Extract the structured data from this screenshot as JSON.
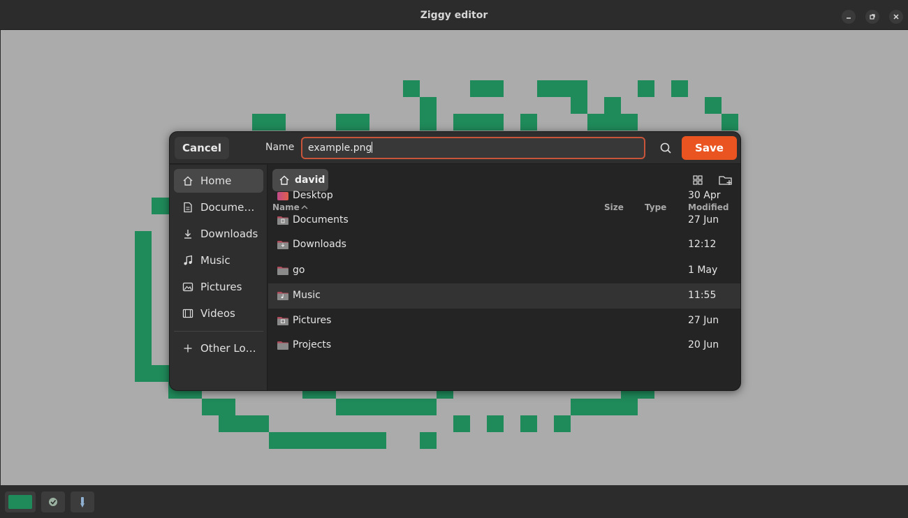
{
  "window": {
    "title": "Ziggy editor",
    "controls": [
      "minimize-icon",
      "restore-icon",
      "close-icon"
    ]
  },
  "canvas": {
    "background": "#ababab",
    "pixel_color": "#1f8a5a"
  },
  "bottom_bar": {
    "current_color": "#1f8a5a",
    "tools": [
      "color-swatch",
      "check-tool-icon",
      "dropper-tool-icon"
    ]
  },
  "dialog": {
    "cancel_label": "Cancel",
    "name_label": "Name",
    "name_value": "example.png",
    "save_label": "Save",
    "save_color": "#e95420",
    "sidebar": [
      {
        "label": "Home",
        "icon": "home-icon",
        "active": true
      },
      {
        "label": "Docume…",
        "icon": "document-icon",
        "active": false
      },
      {
        "label": "Downloads",
        "icon": "download-icon",
        "active": false
      },
      {
        "label": "Music",
        "icon": "music-icon",
        "active": false
      },
      {
        "label": "Pictures",
        "icon": "picture-icon",
        "active": false
      },
      {
        "label": "Videos",
        "icon": "video-icon",
        "active": false
      }
    ],
    "other_locations_label": "Other Lo…",
    "breadcrumb": "david",
    "columns": {
      "name": "Name",
      "size": "Size",
      "type": "Type",
      "modified": "Modified"
    },
    "files": [
      {
        "name": "Desktop",
        "modified": "30 Apr",
        "icon": "desktop-folder-icon"
      },
      {
        "name": "Documents",
        "modified": "27 Jun",
        "icon": "documents-folder-icon"
      },
      {
        "name": "Downloads",
        "modified": "12:12",
        "icon": "downloads-folder-icon"
      },
      {
        "name": "go",
        "modified": "1 May",
        "icon": "folder-icon"
      },
      {
        "name": "Music",
        "modified": "11:55",
        "icon": "music-folder-icon",
        "highlighted": true
      },
      {
        "name": "Pictures",
        "modified": "27 Jun",
        "icon": "pictures-folder-icon"
      },
      {
        "name": "Projects",
        "modified": "20 Jun",
        "icon": "folder-icon"
      }
    ]
  }
}
